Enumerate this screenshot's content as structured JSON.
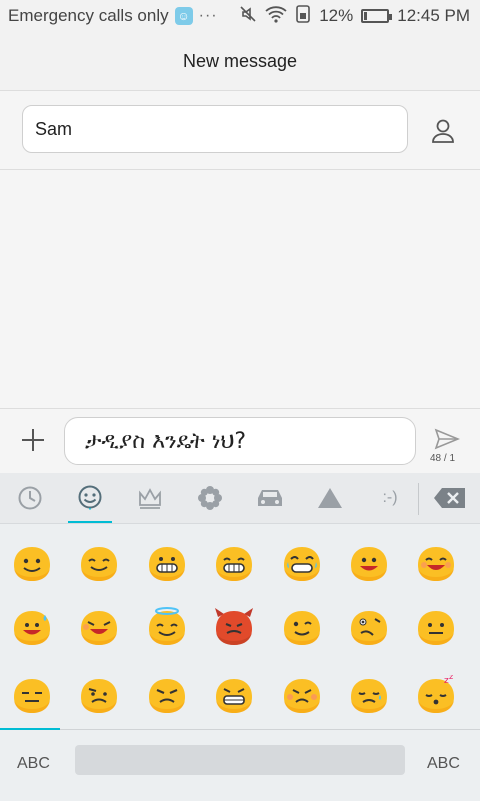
{
  "status": {
    "carrier": "Emergency calls only",
    "more": "···",
    "battery": "12%",
    "time": "12:45 PM"
  },
  "header": {
    "title": "New message"
  },
  "recipient": {
    "value": "Sam"
  },
  "compose": {
    "text": "ታዲያስ እንዴት ነህ?",
    "counter": "48 / 1"
  },
  "keyboard": {
    "categories": [
      "recent-icon",
      "smileys-icon",
      "objects-icon",
      "nature-icon",
      "transport-icon",
      "symbols-icon",
      "emoticons-text"
    ],
    "emoticon_label": ":-)",
    "abc_left": "ABC",
    "abc_right": "ABC",
    "emoji_names": [
      "smile-emoji",
      "grin-emoji",
      "grinning-teeth-emoji",
      "beaming-emoji",
      "tears-of-joy-emoji",
      "smile-open-emoji",
      "laughing-emoji",
      "sweat-smile-emoji",
      "rolling-laugh-emoji",
      "halo-emoji",
      "devil-emoji",
      "wink-emoji",
      "zany-emoji",
      "neutral-emoji",
      "expressionless-emoji",
      "confused-emoji",
      "angry-emoji",
      "grimace-emoji",
      "pouting-emoji",
      "sad-emoji",
      "sleepy-emoji"
    ]
  },
  "colors": {
    "emoji": "#fbbf24",
    "emoji_shade": "#f59e0b",
    "devil": "#e14a2b",
    "accent": "#00bcd4"
  }
}
